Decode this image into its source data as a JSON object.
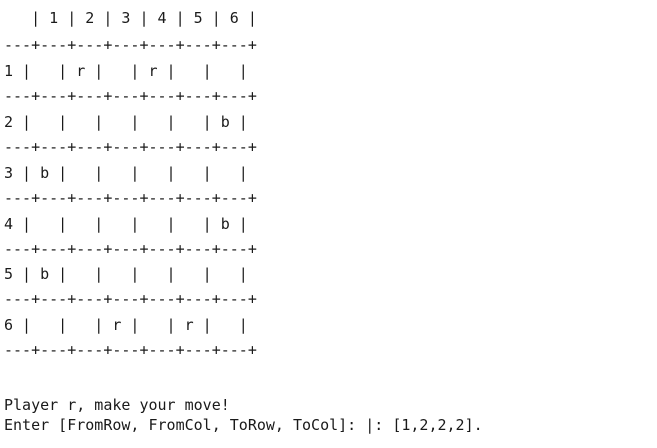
{
  "terminal": {
    "board": {
      "header": "   | 1 | 2 | 3 | 4 | 5 | 6 |",
      "separator": "---+---+---+---+---+---+---+",
      "rows": [
        "1 |   | r |   | r |   |   |",
        "2 |   |   |   |   |   | b |",
        "3 | b |   |   |   |   |   |",
        "4 |   |   |   |   |   | b |",
        "5 | b |   |   |   |   |   |",
        "6 |   |   | r |   | r |   |"
      ]
    },
    "prompt_line": "Player r, make your move!",
    "input_line": "Enter [FromRow, FromCol, ToRow, ToCol]: |: [1,2,2,2]."
  }
}
